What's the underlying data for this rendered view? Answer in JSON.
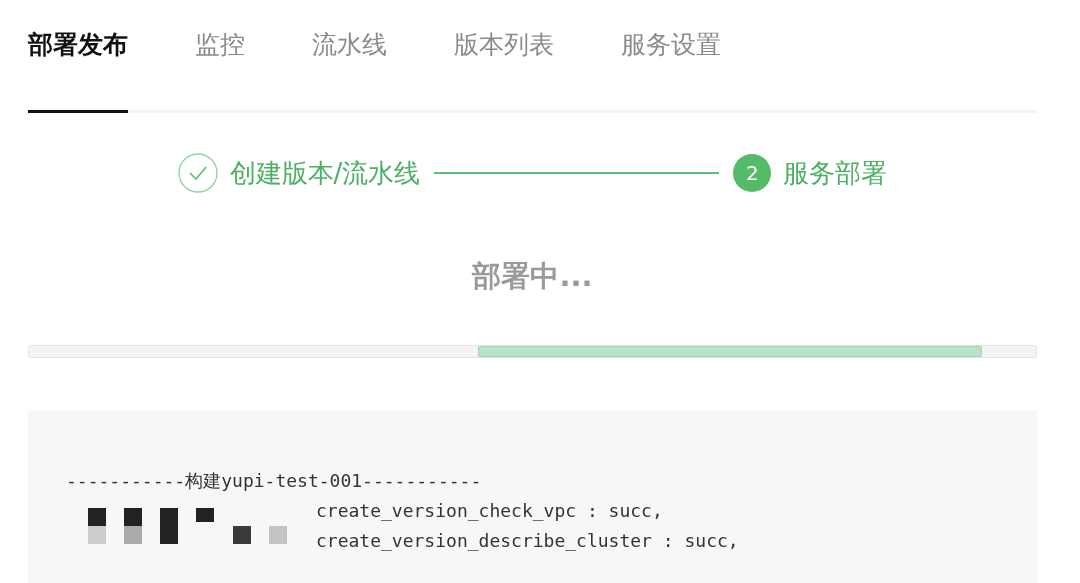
{
  "tabs": [
    {
      "label": "部署发布",
      "selected": true
    },
    {
      "label": "监控",
      "selected": false
    },
    {
      "label": "流水线",
      "selected": false
    },
    {
      "label": "版本列表",
      "selected": false
    },
    {
      "label": "服务设置",
      "selected": false
    }
  ],
  "steps": [
    {
      "label": "创建版本/流水线",
      "kind": "done"
    },
    {
      "label": "服务部署",
      "number": "2",
      "kind": "active"
    }
  ],
  "status_text": "部署中...",
  "log": {
    "lines": [
      "-----------构建yupi-test-001-----------",
      "create_version_check_vpc : succ,",
      "create_version_describe_cluster : succ,"
    ]
  }
}
